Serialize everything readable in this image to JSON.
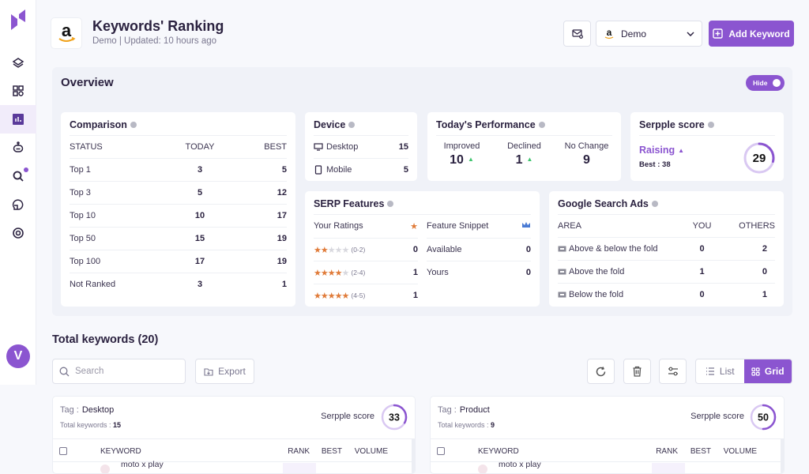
{
  "header": {
    "title": "Keywords' Ranking",
    "subtitle": "Demo | Updated: 10 hours ago",
    "account": "Demo",
    "add_keyword": "Add Keyword"
  },
  "sidebar": {
    "items": [
      {
        "name": "layers",
        "active": false
      },
      {
        "name": "dashboard",
        "active": false
      },
      {
        "name": "rankings-chart",
        "active": true
      },
      {
        "name": "bot",
        "active": false
      },
      {
        "name": "search",
        "active": false,
        "badge": true
      },
      {
        "name": "pie",
        "active": false
      },
      {
        "name": "settings",
        "active": false
      }
    ],
    "avatar": "V"
  },
  "overview": {
    "title": "Overview",
    "hide_label": "Hide",
    "comparison": {
      "title": "Comparison",
      "headers": [
        "STATUS",
        "TODAY",
        "BEST"
      ],
      "rows": [
        {
          "status": "Top 1",
          "today": "3",
          "best": "5"
        },
        {
          "status": "Top 3",
          "today": "5",
          "best": "12"
        },
        {
          "status": "Top 10",
          "today": "10",
          "best": "17"
        },
        {
          "status": "Top 50",
          "today": "15",
          "best": "19"
        },
        {
          "status": "Top 100",
          "today": "17",
          "best": "19"
        },
        {
          "status": "Not Ranked",
          "today": "3",
          "best": "1"
        }
      ]
    },
    "device": {
      "title": "Device",
      "rows": [
        {
          "label": "Desktop",
          "value": "15"
        },
        {
          "label": "Mobile",
          "value": "5"
        }
      ]
    },
    "performance": {
      "title": "Today's Performance",
      "items": [
        {
          "label": "Improved",
          "value": "10",
          "arrow": true
        },
        {
          "label": "Declined",
          "value": "1",
          "arrow": true
        },
        {
          "label": "No Change",
          "value": "9",
          "arrow": false
        }
      ]
    },
    "serpple": {
      "title": "Serpple score",
      "trend": "Raising",
      "best": "Best : 38",
      "score": "29",
      "score_fraction": 0.29
    },
    "serp_features": {
      "title": "SERP Features",
      "ratings_label": "Your Ratings",
      "ratings": [
        {
          "stars": 2,
          "range": "(0-2)",
          "value": "0"
        },
        {
          "stars": 4,
          "range": "(2-4)",
          "value": "1"
        },
        {
          "stars": 5,
          "range": "(4-5)",
          "value": "1"
        }
      ],
      "snippet_label": "Feature Snippet",
      "snippet": [
        {
          "label": "Available",
          "value": "0"
        },
        {
          "label": "Yours",
          "value": "0"
        }
      ]
    },
    "ads": {
      "title": "Google Search Ads",
      "headers": [
        "AREA",
        "YOU",
        "OTHERS"
      ],
      "rows": [
        {
          "area": "Above & below the fold",
          "you": "0",
          "others": "2"
        },
        {
          "area": "Above the fold",
          "you": "1",
          "others": "0"
        },
        {
          "area": "Below the fold",
          "you": "0",
          "others": "1"
        }
      ]
    }
  },
  "keywords": {
    "title": "Total keywords (20)",
    "search_placeholder": "Search",
    "export": "Export",
    "list": "List",
    "grid": "Grid",
    "tags": [
      {
        "tag_label": "Tag :",
        "tag": "Desktop",
        "total_label": "Total keywords :",
        "total": "15",
        "score_label": "Serpple score",
        "score": "33",
        "score_fraction": 0.33,
        "first_keyword": "moto x play"
      },
      {
        "tag_label": "Tag :",
        "tag": "Product",
        "total_label": "Total keywords :",
        "total": "9",
        "score_label": "Serpple score",
        "score": "50",
        "score_fraction": 0.5,
        "first_keyword": "moto x play"
      }
    ],
    "columns": [
      "KEYWORD",
      "RANK",
      "BEST",
      "VOLUME"
    ]
  },
  "colors": {
    "accent": "#8b55d0",
    "star": "#e07b39",
    "up": "#3ec46d"
  }
}
